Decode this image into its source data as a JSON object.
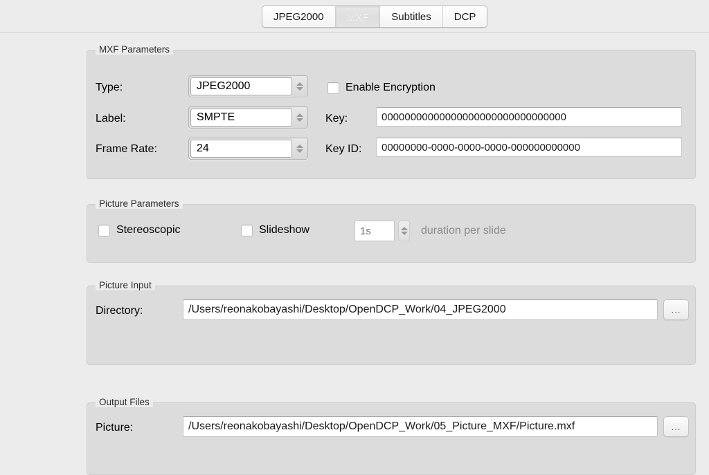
{
  "tabs": [
    {
      "label": "JPEG2000",
      "selected": false
    },
    {
      "label": "MXF",
      "selected": true
    },
    {
      "label": "Subtitles",
      "selected": false
    },
    {
      "label": "DCP",
      "selected": false
    }
  ],
  "mxf_parameters": {
    "group_title": "MXF Parameters",
    "type_label": "Type:",
    "type_value": "JPEG2000",
    "label_label": "Label:",
    "label_value": "SMPTE",
    "frame_rate_label": "Frame Rate:",
    "frame_rate_value": "24",
    "enable_encryption_label": "Enable Encryption",
    "enable_encryption_checked": false,
    "key_label": "Key:",
    "key_value": "00000000000000000000000000000000",
    "key_id_label": "Key ID:",
    "key_id_value": "00000000-0000-0000-0000-000000000000"
  },
  "picture_parameters": {
    "group_title": "Picture Parameters",
    "stereoscopic_label": "Stereoscopic",
    "stereoscopic_checked": false,
    "slideshow_label": "Slideshow",
    "slideshow_checked": false,
    "duration_value": "1s",
    "duration_caption": "duration per slide"
  },
  "picture_input": {
    "group_title": "Picture Input",
    "directory_label": "Directory:",
    "directory_value": "/Users/reonakobayashi/Desktop/OpenDCP_Work/04_JPEG2000",
    "browse_label": "..."
  },
  "output_files": {
    "group_title": "Output Files",
    "picture_label": "Picture:",
    "picture_value": "/Users/reonakobayashi/Desktop/OpenDCP_Work/05_Picture_MXF/Picture.mxf",
    "browse_label": "..."
  },
  "colors": {
    "window_bg": "#ececec",
    "group_bg": "#dcdcdc",
    "field_bg": "#ffffff",
    "text": "#000000",
    "disabled_text": "#8c8c8c"
  }
}
